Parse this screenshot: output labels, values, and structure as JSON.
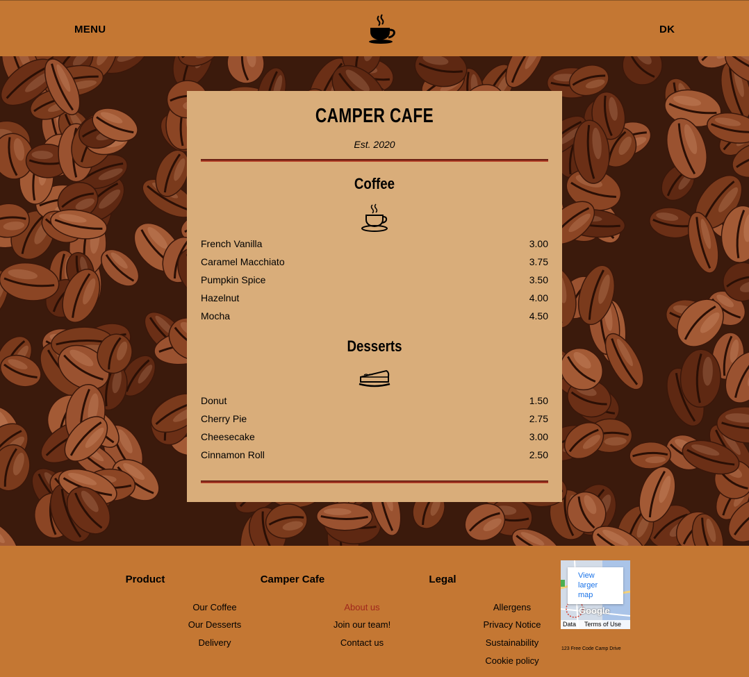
{
  "header": {
    "menu_label": "MENU",
    "lang_label": "DK",
    "logo_icon": "coffee-cup-icon"
  },
  "menu": {
    "title": "CAMPER CAFE",
    "established": "Est. 2020",
    "sections": [
      {
        "title": "Coffee",
        "icon": "coffee-cup-icon",
        "items": [
          {
            "name": "French Vanilla",
            "price": "3.00"
          },
          {
            "name": "Caramel Macchiato",
            "price": "3.75"
          },
          {
            "name": "Pumpkin Spice",
            "price": "3.50"
          },
          {
            "name": "Hazelnut",
            "price": "4.00"
          },
          {
            "name": "Mocha",
            "price": "4.50"
          }
        ]
      },
      {
        "title": "Desserts",
        "icon": "pie-icon",
        "items": [
          {
            "name": "Donut",
            "price": "1.50"
          },
          {
            "name": "Cherry Pie",
            "price": "2.75"
          },
          {
            "name": "Cheesecake",
            "price": "3.00"
          },
          {
            "name": "Cinnamon Roll",
            "price": "2.50"
          }
        ]
      }
    ]
  },
  "footer": {
    "columns": [
      {
        "title": "Product",
        "links": [
          "Our Coffee",
          "Our Desserts",
          "Delivery"
        ]
      },
      {
        "title": "Camper Cafe",
        "links": [
          "About us",
          "Join our team!",
          "Contact us"
        ]
      },
      {
        "title": "Legal",
        "links": [
          "Allergens",
          "Privacy Notice",
          "Sustainability",
          "Cookie policy"
        ]
      }
    ],
    "map": {
      "popup_link": "View larger map",
      "brand": "Google",
      "data_label": "Data",
      "terms_label": "Terms of Use"
    },
    "address": "123 Free Code Camp Drive"
  },
  "colors": {
    "background": "#c47733",
    "card": "#d9ad7a",
    "divider": "#8a2b1c",
    "active_link": "#a0281c"
  }
}
